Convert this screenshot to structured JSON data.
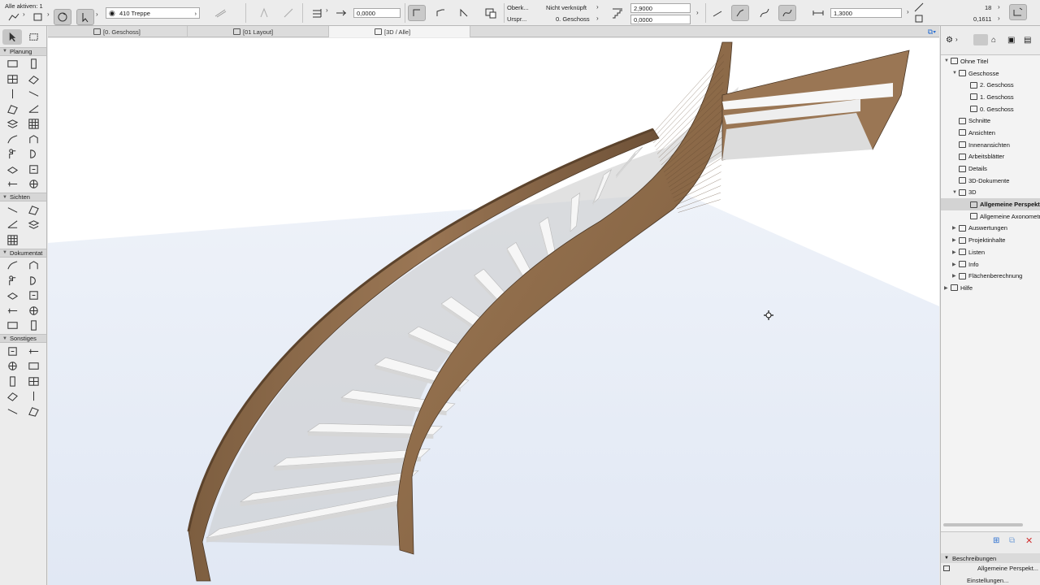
{
  "toolbar": {
    "selection_info": "Alle aktiven: 1",
    "stair_name": "410 Treppe",
    "offset_value": "0,0000",
    "top_label": "Oberk...",
    "top_link": "Nicht verknüpft",
    "origin_label": "Urspr...",
    "origin_story": "0. Geschoss",
    "height_value": "2,9000",
    "base_value": "0,0000",
    "width_value": "1,3000",
    "riser_count": "18",
    "riser_height": "0,1611"
  },
  "toolbox": {
    "sections": [
      {
        "label": "Planung",
        "tools": 18
      },
      {
        "label": "Sichten",
        "tools": 5
      },
      {
        "label": "Dokumentat",
        "tools": 10
      },
      {
        "label": "Sonstiges",
        "tools": 10
      }
    ]
  },
  "tabs": [
    {
      "label": "[0. Geschoss]",
      "active": false
    },
    {
      "label": "[01 Layout]",
      "active": false
    },
    {
      "label": "[3D / Alle]",
      "active": true
    }
  ],
  "navigator": {
    "items": [
      {
        "label": "Ohne Titel",
        "level": 0,
        "expanded": true
      },
      {
        "label": "Geschosse",
        "level": 1,
        "expanded": true
      },
      {
        "label": "2. Geschoss",
        "level": 2
      },
      {
        "label": "1. Geschoss",
        "level": 2
      },
      {
        "label": "0. Geschoss",
        "level": 2
      },
      {
        "label": "Schnitte",
        "level": 1
      },
      {
        "label": "Ansichten",
        "level": 1
      },
      {
        "label": "Innenansichten",
        "level": 1
      },
      {
        "label": "Arbeitsblätter",
        "level": 1
      },
      {
        "label": "Details",
        "level": 1
      },
      {
        "label": "3D-Dokumente",
        "level": 1
      },
      {
        "label": "3D",
        "level": 1,
        "expanded": true
      },
      {
        "label": "Allgemeine Perspektive",
        "level": 2,
        "selected": true
      },
      {
        "label": "Allgemeine Axonometrie",
        "level": 2
      },
      {
        "label": "Auswertungen",
        "level": 1,
        "collapsed": true
      },
      {
        "label": "Projektinhalte",
        "level": 1,
        "collapsed": true
      },
      {
        "label": "Listen",
        "level": 1,
        "collapsed": true
      },
      {
        "label": "Info",
        "level": 1,
        "collapsed": true
      },
      {
        "label": "Flächenberechnung",
        "level": 1,
        "collapsed": true
      },
      {
        "label": "Hilfe",
        "level": 0,
        "collapsed": true
      }
    ],
    "descriptions_label": "Beschreibungen",
    "description_value": "Allgemeine Perspekt...",
    "settings_label": "Einstellungen..."
  },
  "colors": {
    "wood": "#8a6a4a",
    "wood_dark": "#5e4530",
    "floor": "#e6ecf6",
    "tread": "#f4f4f4"
  }
}
